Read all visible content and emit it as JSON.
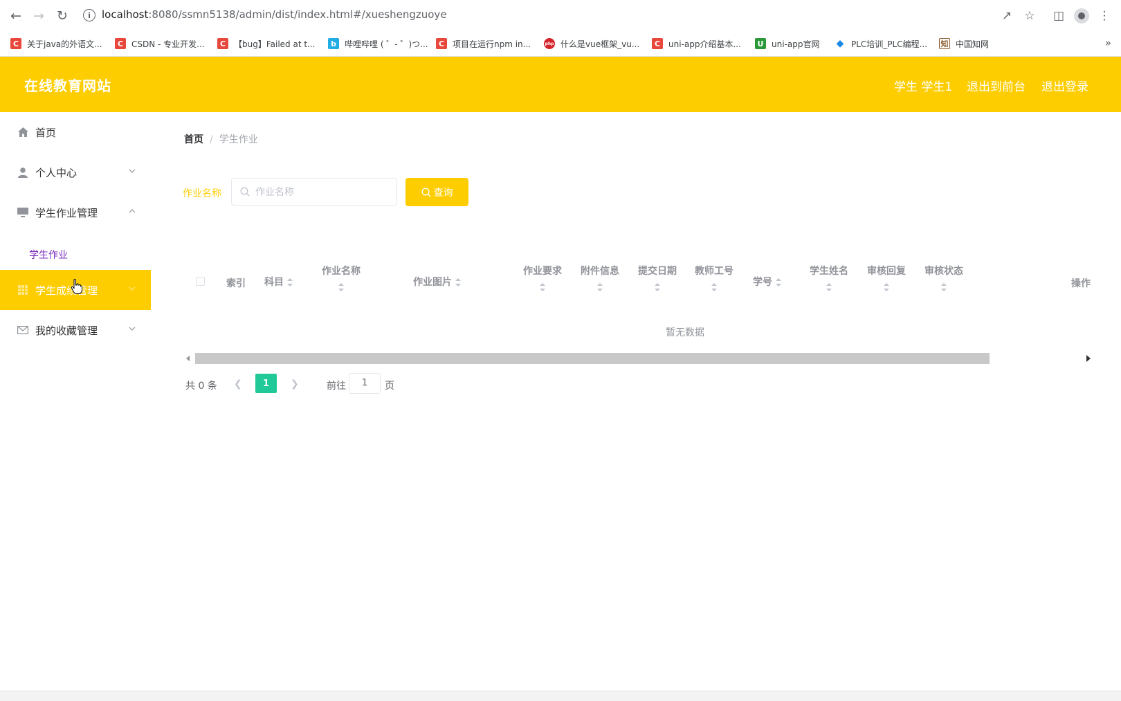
{
  "browser": {
    "url_host": "localhost",
    "url_rest": ":8080/ssmn5138/admin/dist/index.html#/xueshengzuoye",
    "bookmarks": [
      {
        "label": "关于java的外语文...",
        "icon_color": "#e8473b",
        "icon_letter": "C"
      },
      {
        "label": "CSDN - 专业开发...",
        "icon_color": "#e8473b",
        "icon_letter": "C"
      },
      {
        "label": "【bug】Failed at t...",
        "icon_color": "#e8473b",
        "icon_letter": "C"
      },
      {
        "label": "哔哩哔哩 ( ゜- ゜)つ...",
        "icon_color": "#23ade5",
        "icon_letter": "b"
      },
      {
        "label": "项目在运行npm in...",
        "icon_color": "#e8473b",
        "icon_letter": "C"
      },
      {
        "label": "什么是vue框架_vu...",
        "icon_color": "#d4232b",
        "icon_letter": "php"
      },
      {
        "label": "uni-app介绍基本...",
        "icon_color": "#e8473b",
        "icon_letter": "C"
      },
      {
        "label": "uni-app官网",
        "icon_color": "#2b9939",
        "icon_letter": "U"
      },
      {
        "label": "PLC培训_PLC编程...",
        "icon_color": "#1e88e5",
        "icon_letter": "◆"
      },
      {
        "label": "中国知网",
        "icon_color": "#8b5a2b",
        "icon_letter": "知"
      }
    ],
    "more_label": "»"
  },
  "header": {
    "title": "在线教育网站",
    "user_label": "学生 学生1",
    "back_front_label": "退出到前台",
    "logout_label": "退出登录",
    "accent_color": "#fecd00"
  },
  "sidebar": {
    "items": [
      {
        "label": "首页",
        "icon": "home-icon"
      },
      {
        "label": "个人中心",
        "icon": "user-icon"
      },
      {
        "label": "学生作业管理",
        "icon": "monitor-icon"
      },
      {
        "label": "学生成绩管理",
        "icon": "grid-icon"
      },
      {
        "label": "我的收藏管理",
        "icon": "mail-icon"
      }
    ],
    "submenu_item": "学生作业"
  },
  "breadcrumb": {
    "home": "首页",
    "separator": "/",
    "current": "学生作业"
  },
  "search": {
    "label": "作业名称",
    "placeholder": "作业名称",
    "button_label": "查询"
  },
  "table": {
    "columns": [
      "索引",
      "科目",
      "作业名称",
      "作业图片",
      "作业要求",
      "附件信息",
      "提交日期",
      "教师工号",
      "学号",
      "学生姓名",
      "审核回复",
      "审核状态",
      "操作"
    ],
    "empty_text": "暂无数据",
    "rows": []
  },
  "pagination": {
    "total_label": "共 0 条",
    "current_page": "1",
    "goto_prefix": "前往",
    "goto_value": "1",
    "goto_suffix": "页",
    "active_color": "#20c997"
  }
}
